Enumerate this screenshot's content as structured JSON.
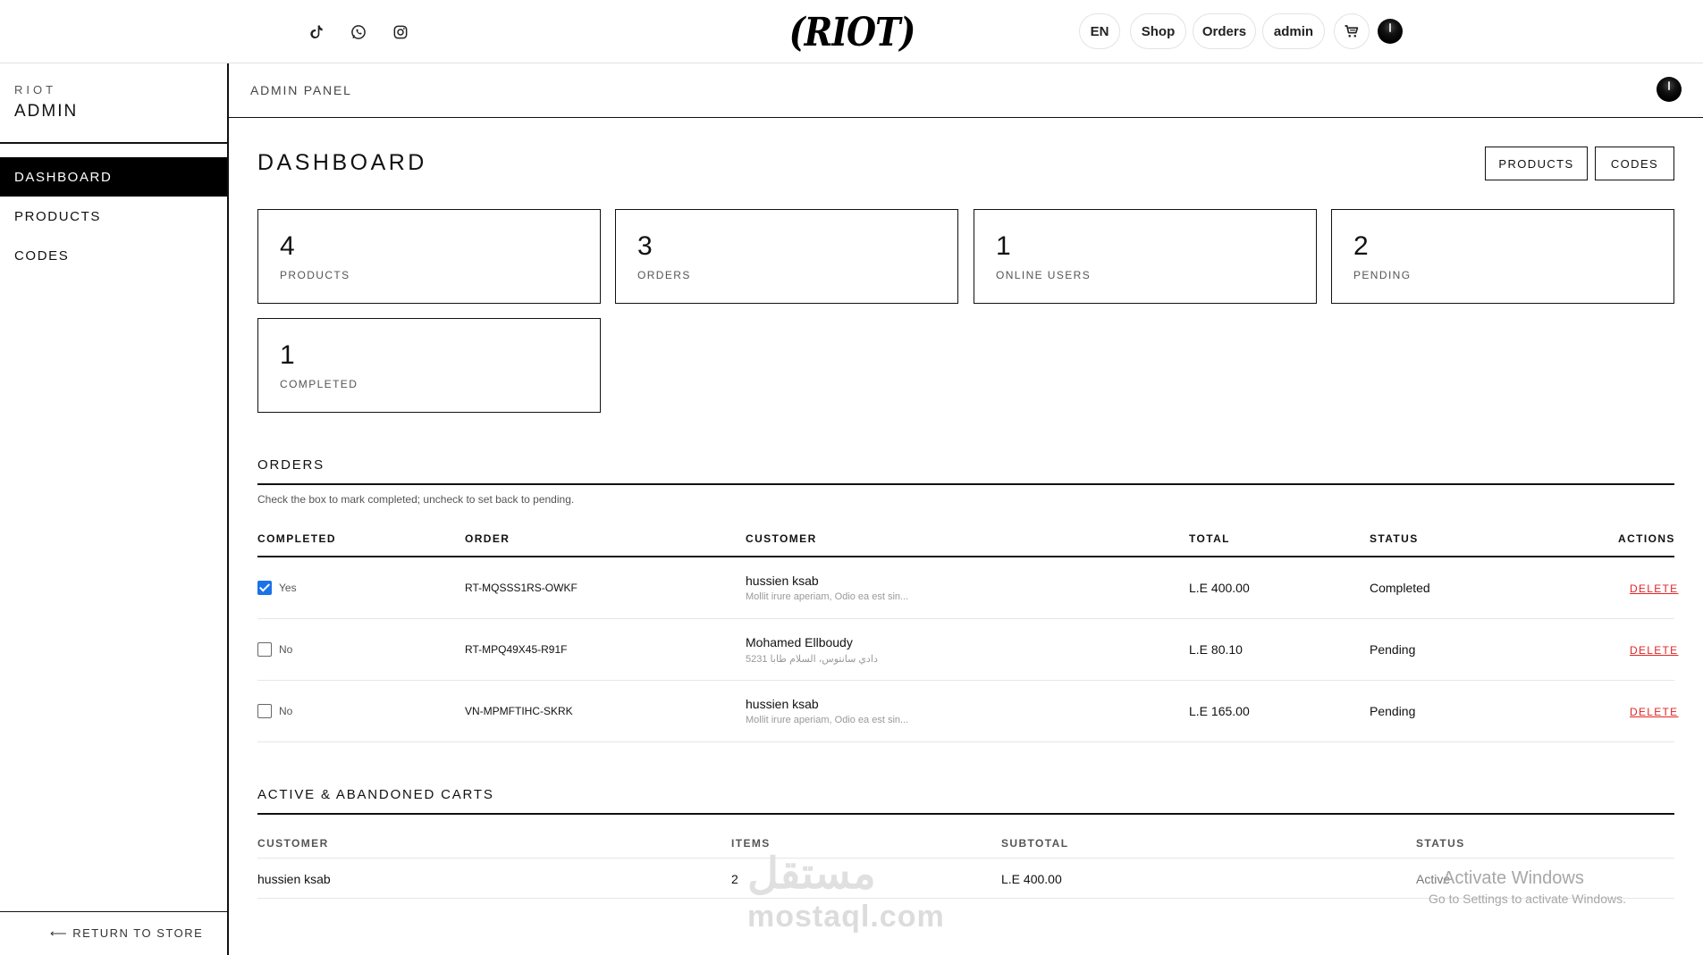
{
  "topbar": {
    "logo_text": "RIOT",
    "nav": {
      "lang": "EN",
      "shop": "Shop",
      "orders": "Orders",
      "user": "admin"
    },
    "social_icons": [
      "tiktok-icon",
      "whatsapp-icon",
      "instagram-icon"
    ]
  },
  "sidebar": {
    "brand_small": "RIOT",
    "brand_big": "ADMIN",
    "items": [
      {
        "label": "DASHBOARD",
        "active": true
      },
      {
        "label": "PRODUCTS",
        "active": false
      },
      {
        "label": "CODES",
        "active": false
      }
    ],
    "return_link": "⟵ RETURN TO STORE"
  },
  "header": {
    "panel_title": "ADMIN PANEL"
  },
  "page": {
    "title": "DASHBOARD",
    "buttons": {
      "products": "PRODUCTS",
      "codes": "CODES"
    }
  },
  "stats": [
    {
      "value": "4",
      "label": "PRODUCTS"
    },
    {
      "value": "3",
      "label": "ORDERS"
    },
    {
      "value": "1",
      "label": "ONLINE USERS"
    },
    {
      "value": "2",
      "label": "PENDING"
    },
    {
      "value": "1",
      "label": "COMPLETED"
    }
  ],
  "orders": {
    "title": "ORDERS",
    "hint": "Check the box to mark completed; uncheck to set back to pending.",
    "columns": {
      "completed": "COMPLETED",
      "order": "ORDER",
      "customer": "CUSTOMER",
      "total": "TOTAL",
      "status": "STATUS",
      "actions": "ACTIONS"
    },
    "rows": [
      {
        "checked": true,
        "completed": "Yes",
        "order": "RT-MQSSS1RS-OWKF",
        "customer": "hussien ksab",
        "address": "Mollit irure aperiam, Odio ea est sin...",
        "total": "L.E 400.00",
        "status": "Completed",
        "action": "DELETE"
      },
      {
        "checked": false,
        "completed": "No",
        "order": "RT-MPQ49X45-R91F",
        "customer": "Mohamed Ellboudy",
        "address": "5231 دادي سانتوس، السلام طابا",
        "total": "L.E 80.10",
        "status": "Pending",
        "action": "DELETE"
      },
      {
        "checked": false,
        "completed": "No",
        "order": "VN-MPMFTIHC-SKRK",
        "customer": "hussien ksab",
        "address": "Mollit irure aperiam, Odio ea est sin...",
        "total": "L.E 165.00",
        "status": "Pending",
        "action": "DELETE"
      }
    ]
  },
  "carts": {
    "title": "ACTIVE & ABANDONED CARTS",
    "columns": {
      "customer": "CUSTOMER",
      "items": "ITEMS",
      "subtotal": "SUBTOTAL",
      "status": "STATUS"
    },
    "rows": [
      {
        "customer": "hussien ksab",
        "items": "2",
        "subtotal": "L.E 400.00",
        "status": "Active"
      }
    ]
  },
  "overlay": {
    "watermark": "mostaql.com",
    "watermark_ar": "مستقل",
    "windows_line1": "Activate Windows",
    "windows_line2": "Go to Settings to activate Windows."
  },
  "colors": {
    "accent_check": "#1a73e8",
    "delete": "#e02424",
    "sidebar_active_bg": "#000000"
  }
}
